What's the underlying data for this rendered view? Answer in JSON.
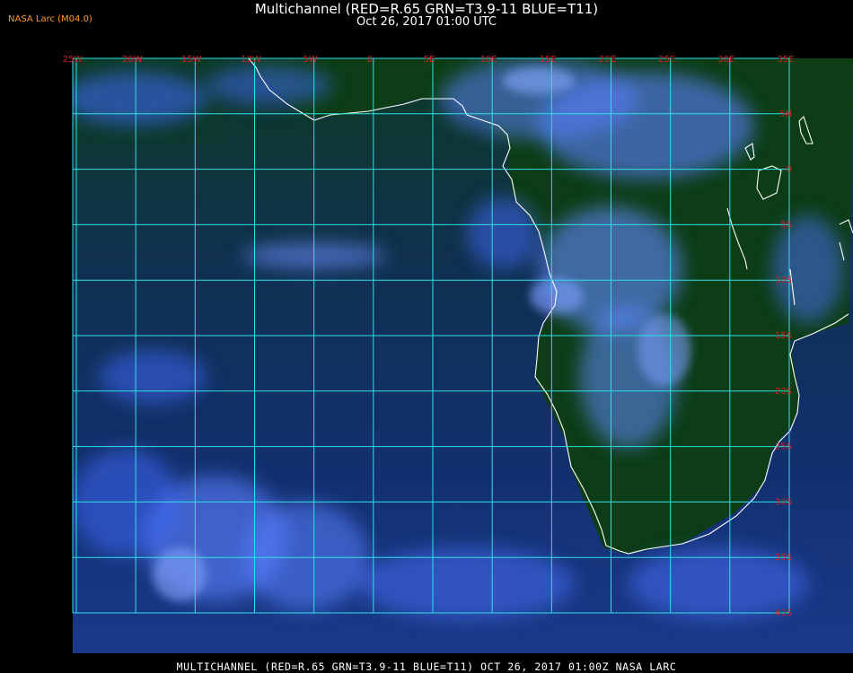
{
  "header": {
    "title": "Multichannel (RED=R.65 GRN=T3.9-11 BLUE=T11)",
    "timestamp": "Oct 26, 2017 01:00 UTC"
  },
  "credit": "NASA Larc (M04.0)",
  "footer": "MULTICHANNEL (RED=R.65 GRN=T3.9-11 BLUE=T11) OCT 26, 2017 01:00Z  NASA LARC",
  "grid": {
    "lon_labels": [
      "25W",
      "20W",
      "15W",
      "10W",
      "5W",
      "0",
      "5E",
      "10E",
      "15E",
      "20E",
      "25E",
      "30E",
      "35E"
    ],
    "lat_labels": [
      "5N",
      "0",
      "5S",
      "10S",
      "15S",
      "20S",
      "25S",
      "30S",
      "35S",
      "40S"
    ]
  },
  "colors": {
    "grid_line": "#2fe0e6",
    "grid_label": "#d11f1f",
    "coastline": "#ffffff",
    "land": "#0b3b14",
    "ocean": "#0f2a6b",
    "cloud": "#4f78ff"
  }
}
